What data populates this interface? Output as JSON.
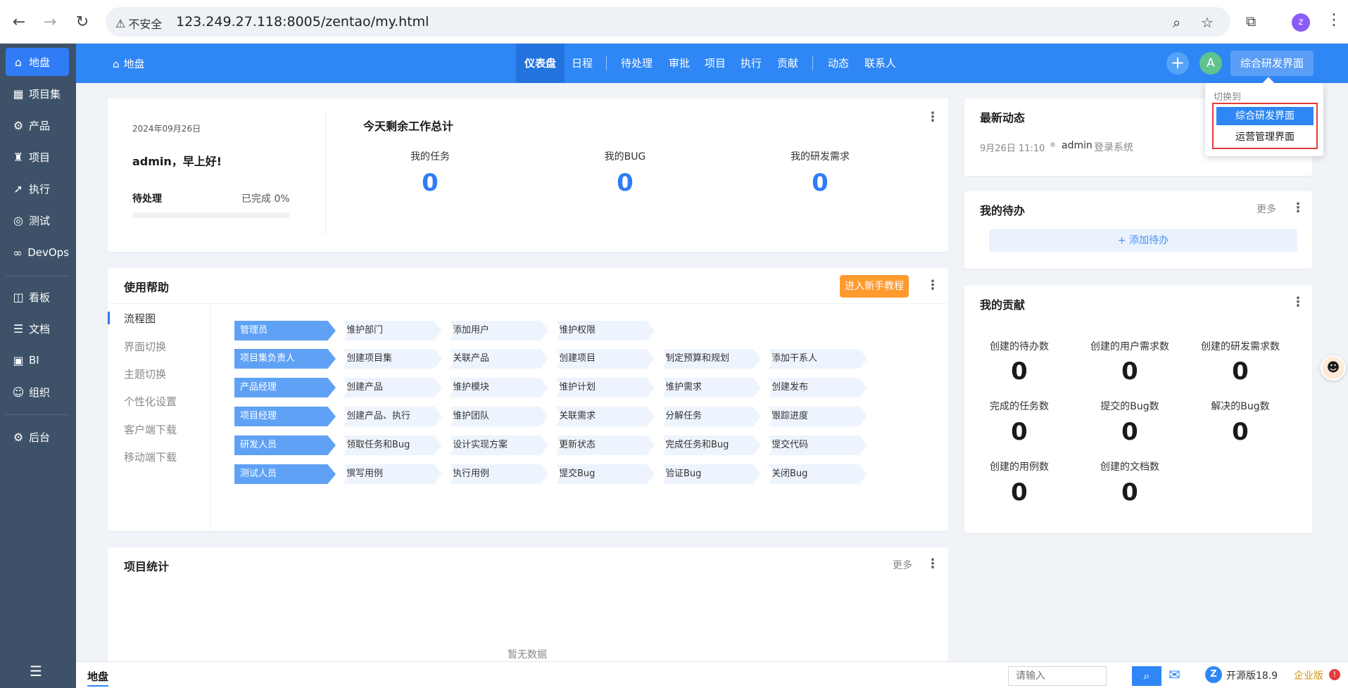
{
  "browser": {
    "insecure_label": "不安全",
    "url": "123.249.27.118:8005/zentao/my.html",
    "profile_letter": "z"
  },
  "sidebar": {
    "items": [
      {
        "label": "地盘",
        "icon": "home-icon"
      },
      {
        "label": "项目集",
        "icon": "grid-icon"
      },
      {
        "label": "产品",
        "icon": "product-icon"
      },
      {
        "label": "项目",
        "icon": "rocket-icon"
      },
      {
        "label": "执行",
        "icon": "run-icon"
      },
      {
        "label": "测试",
        "icon": "test-icon"
      },
      {
        "label": "DevOps",
        "icon": "infinity-icon"
      },
      {
        "label": "看板",
        "icon": "kanban-icon"
      },
      {
        "label": "文档",
        "icon": "doc-icon"
      },
      {
        "label": "BI",
        "icon": "chart-icon"
      },
      {
        "label": "组织",
        "icon": "people-icon"
      },
      {
        "label": "后台",
        "icon": "gear-icon"
      }
    ]
  },
  "header": {
    "home_label": "地盘",
    "nav": [
      "仪表盘",
      "日程",
      "待处理",
      "审批",
      "项目",
      "执行",
      "贡献",
      "动态",
      "联系人"
    ],
    "avatar_letter": "A",
    "switch_label": "综合研发界面"
  },
  "dropdown": {
    "title": "切换到",
    "items": [
      "综合研发界面",
      "运营管理界面"
    ]
  },
  "welcome": {
    "date": "2024年09月26日",
    "greeting": "admin，早上好!",
    "pending_label": "待处理",
    "done_label": "已完成 0%",
    "progress": 0
  },
  "today": {
    "title": "今天剩余工作总计",
    "stats": [
      {
        "label": "我的任务",
        "value": "0"
      },
      {
        "label": "我的BUG",
        "value": "0"
      },
      {
        "label": "我的研发需求",
        "value": "0"
      }
    ]
  },
  "help": {
    "title": "使用帮助",
    "tutorial_button": "进入新手教程",
    "nav": [
      "流程图",
      "界面切换",
      "主题切换",
      "个性化设置",
      "客户端下载",
      "移动端下载"
    ],
    "rows": [
      {
        "role": "管理员",
        "steps": [
          "维护部门",
          "添加用户",
          "维护权限"
        ]
      },
      {
        "role": "项目集负责人",
        "steps": [
          "创建项目集",
          "关联产品",
          "创建项目",
          "制定预算和规划",
          "添加干系人"
        ]
      },
      {
        "role": "产品经理",
        "steps": [
          "创建产品",
          "维护模块",
          "维护计划",
          "维护需求",
          "创建发布"
        ]
      },
      {
        "role": "项目经理",
        "steps": [
          "创建产品、执行",
          "维护团队",
          "关联需求",
          "分解任务",
          "跟踪进度"
        ]
      },
      {
        "role": "研发人员",
        "steps": [
          "领取任务和Bug",
          "设计实现方案",
          "更新状态",
          "完成任务和Bug",
          "提交代码"
        ]
      },
      {
        "role": "测试人员",
        "steps": [
          "撰写用例",
          "执行用例",
          "提交Bug",
          "验证Bug",
          "关闭Bug"
        ]
      }
    ]
  },
  "project_stats": {
    "title": "项目统计",
    "more": "更多",
    "empty": "暂无数据"
  },
  "activity": {
    "title": "最新动态",
    "time": "9月26日 11:10",
    "user": "admin",
    "action": "登录系统"
  },
  "todo": {
    "title": "我的待办",
    "more": "更多",
    "add": "+ 添加待办"
  },
  "contrib": {
    "title": "我的贡献",
    "items": [
      {
        "label": "创建的待办数",
        "value": "0"
      },
      {
        "label": "创建的用户需求数",
        "value": "0"
      },
      {
        "label": "创建的研发需求数",
        "value": "0"
      },
      {
        "label": "完成的任务数",
        "value": "0"
      },
      {
        "label": "提交的Bug数",
        "value": "0"
      },
      {
        "label": "解决的Bug数",
        "value": "0"
      },
      {
        "label": "创建的用例数",
        "value": "0"
      },
      {
        "label": "创建的文档数",
        "value": "0"
      }
    ]
  },
  "bottom": {
    "tab": "地盘",
    "search_placeholder": "请输入",
    "version": "开源版18.9",
    "enterprise": "企业版"
  }
}
